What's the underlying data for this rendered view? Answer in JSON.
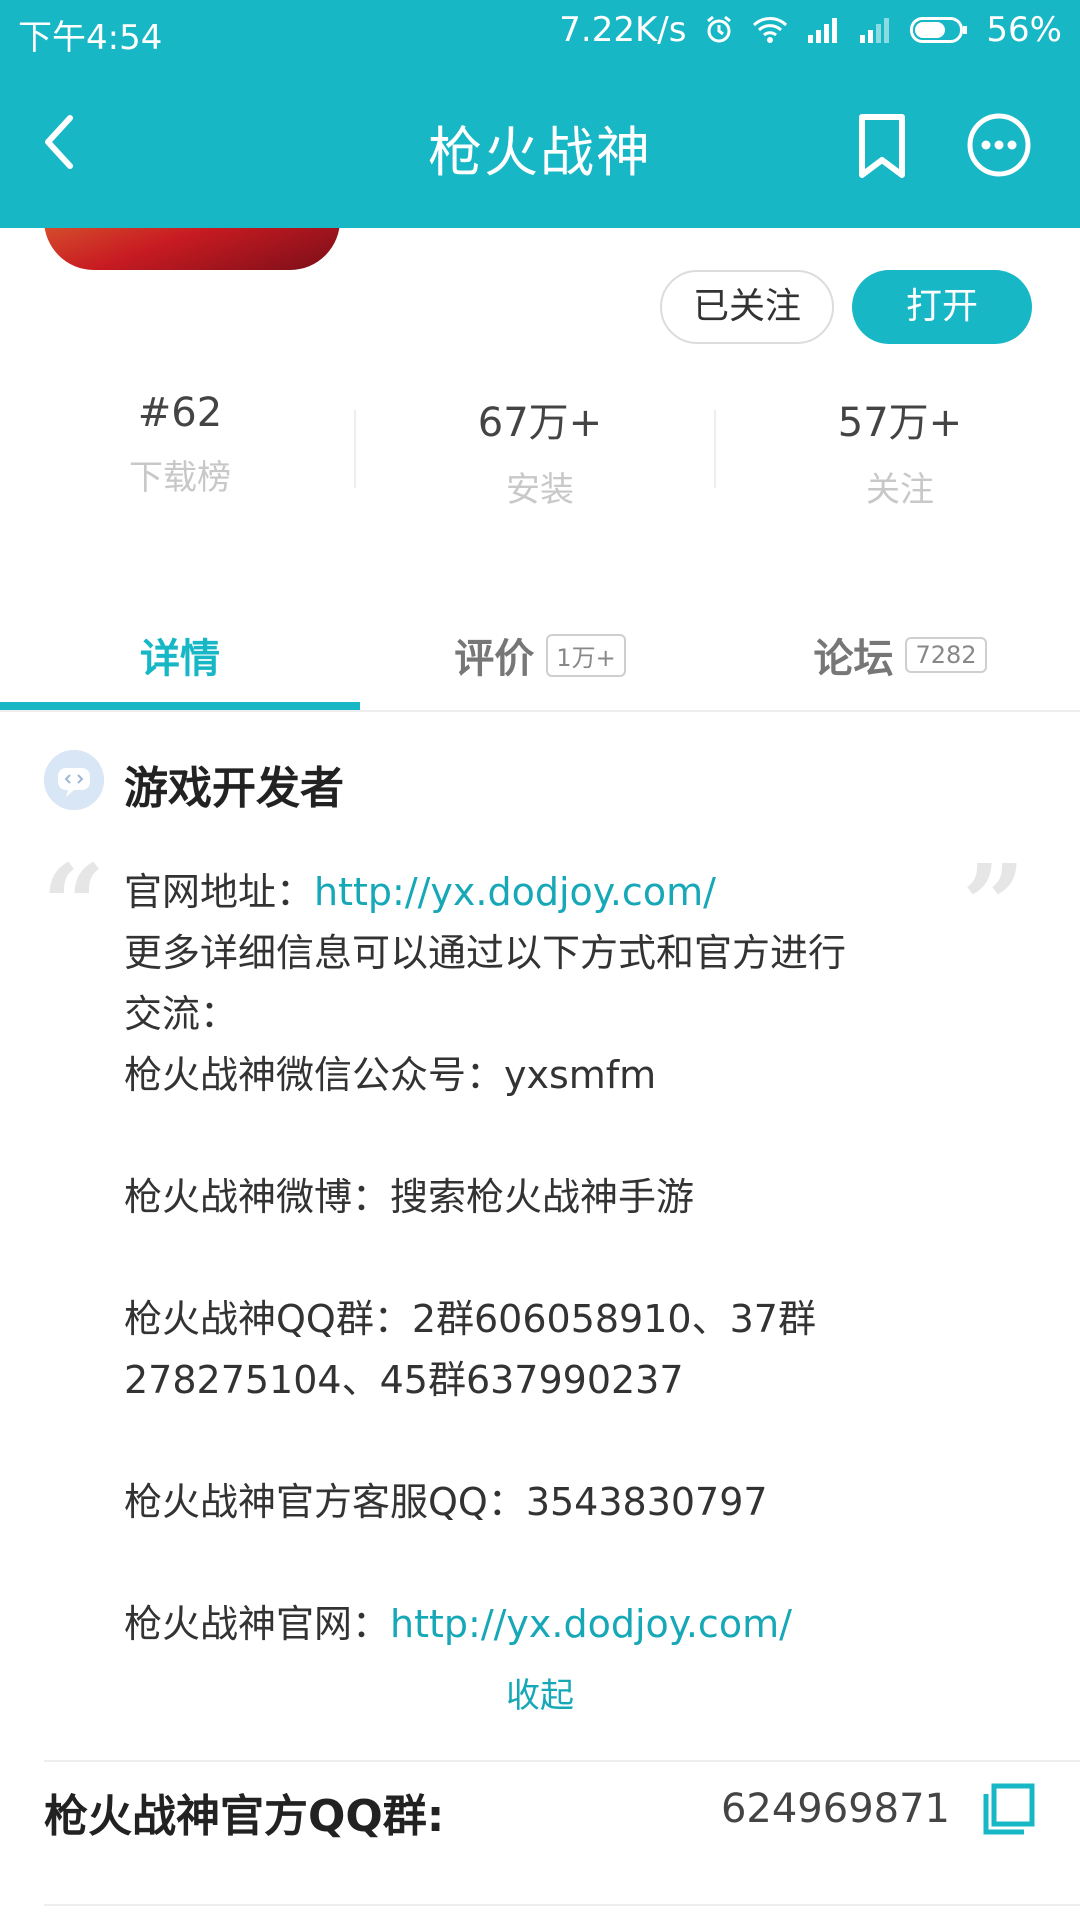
{
  "status_bar": {
    "time": "下午4:54",
    "speed": "7.22K/s",
    "battery": "56%"
  },
  "title_bar": {
    "title": "枪火战神"
  },
  "header": {
    "follow_label": "已关注",
    "open_label": "打开",
    "stats": [
      {
        "value": "#62",
        "label": "下载榜"
      },
      {
        "value": "67万+",
        "label": "安装"
      },
      {
        "value": "57万+",
        "label": "关注"
      }
    ]
  },
  "tabs": [
    {
      "label": "详情",
      "badge": "",
      "active": true
    },
    {
      "label": "评价",
      "badge": "1万+",
      "active": false
    },
    {
      "label": "论坛",
      "badge": "7282",
      "active": false
    }
  ],
  "developer": {
    "title": "游戏开发者",
    "website_label": "官网地址：",
    "website_url": "http://yx.dodjoy.com/",
    "lines": [
      "更多详细信息可以通过以下方式和官方进行",
      "交流：",
      "枪火战神微信公众号：yxsmfm",
      "",
      "枪火战神微博：搜索枪火战神手游",
      "",
      "枪火战神QQ群：2群606058910、37群",
      "278275104、45群637990237",
      "",
      "枪火战神官方客服QQ：3543830797",
      ""
    ],
    "official_label": "枪火战神官网：",
    "official_url": "http://yx.dodjoy.com/",
    "collapse_label": "收起"
  },
  "qq_group": {
    "label": "枪火战神官方QQ群:",
    "value": "624969871"
  },
  "colors": {
    "accent": "#17b7c6",
    "link": "#17a8b8"
  }
}
